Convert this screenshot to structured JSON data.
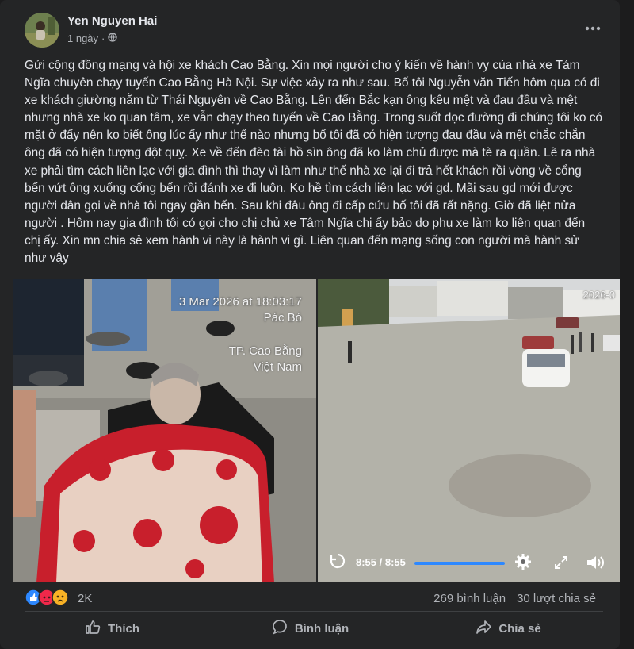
{
  "post": {
    "author": "Yen Nguyen Hai",
    "time": "1 ngày",
    "privacy_sep": "·",
    "text": "Gửi cộng đồng mạng và hội xe khách Cao Bằng. Xin mọi người cho ý kiến về hành vy của nhà xe Tám Ngĩa chuyên chạy tuyến Cao Bằng Hà Nội. Sự việc xảy ra như sau. Bố tôi  Nguyễn văn Tiến hôm qua có đi xe khách giường nằm từ Thái Nguyên về Cao Bằng.  Lên đến Bắc kạn ông kêu mệt và đau đầu và mệt nhưng nhà xe ko quan tâm, xe vẫn chạy theo tuyến về Cao Bằng. Trong suốt dọc đường đi chúng tôi ko có mặt ở đấy nên ko biết ông lúc ấy như thế nào  nhưng bố tôi đã có hiện tượng đau đầu và mệt chắc chắn ông đã có hiện tượng đột quỵ. Xe về đến đèo tài hồ sìn ông đã ko làm chủ được mà tè ra quần. Lẽ ra nhà xe phải tìm cách liên lạc với gia đình thì thay vì làm như thế nhà xe lại đi trả hết khách rồi vòng về cổng bến vứt ông xuống cổng bến rồi đánh xe đi luôn. Ko hề tìm cách liên lạc với gd. Mãi sau gd mới được người dân gọi về nhà tôi ngay gần bến. Sau khi đâu ông đi cấp cứu bố tôi đã rất nặng. Giờ đã liệt nửa người . Hôm nay gia đình tôi có gọi cho chị chủ xe Tâm Ngĩa chị ấy bảo do phụ xe làm ko liên quan đến chị ấy. Xin mn chia sẻ xem hành vi này là hành vi gì. Liên quan đến mạng sống con người mà hành sử như vậy"
  },
  "photo": {
    "stamp_line1": "3 Mar 2026 at 18:03:17",
    "stamp_line2": "Pác Bó",
    "stamp_line3": "TP. Cao Bằng",
    "stamp_line4": "Việt Nam"
  },
  "video": {
    "cam_time": "2026-0",
    "time": "8:55 / 8:55",
    "progress": 1.0
  },
  "reactions": {
    "count": "2K"
  },
  "stats": {
    "comments": "269 bình luận",
    "shares": "30 lượt chia sẻ"
  },
  "actions": {
    "like": "Thích",
    "comment": "Bình luận",
    "share": "Chia sẻ"
  },
  "colors": {
    "like_blue": "#2d88ff",
    "angry": "#f0284a",
    "sad": "#f7b125",
    "background": "#242526",
    "text": "#e4e6eb",
    "muted": "#b0b3b8"
  }
}
